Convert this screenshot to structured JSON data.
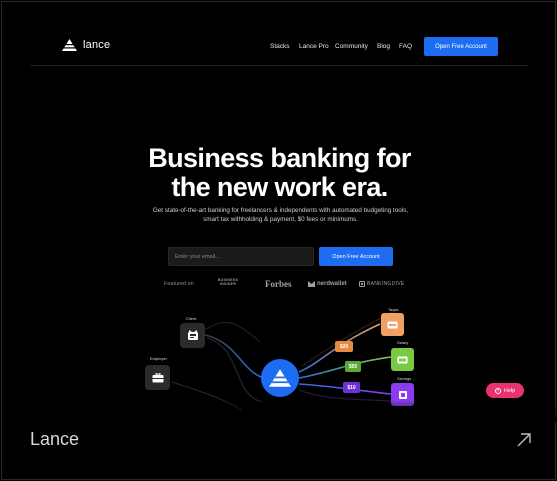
{
  "nav": {
    "brand": "lance",
    "links": [
      "Stacks",
      "Lance Pro",
      "Community",
      "Blog",
      "FAQ"
    ],
    "cta": "Open Free Account"
  },
  "hero": {
    "title_line1": "Business banking for",
    "title_line2": "the new work era.",
    "subtitle": "Get state-of-the-art banking for freelancers & independents with automated budgeting tools, smart tax withholding & payment, $0 fees or minimums.",
    "email_placeholder": "Enter your email...",
    "cta": "Open Free Account"
  },
  "press": {
    "featured_label": "Featured on",
    "business_insider": "BUSINESS INSIDER",
    "forbes": "Forbes",
    "nerdwallet": "nerdwallet",
    "bankingdive": "BANKINGDIVE"
  },
  "diagram": {
    "sources": [
      {
        "label": "Client",
        "icon": "briefcase-icon"
      },
      {
        "label": "Employer",
        "icon": "briefcase-icon"
      }
    ],
    "destinations": [
      {
        "label": "Taxes",
        "amount": "$20",
        "color": "#f0a063"
      },
      {
        "label": "Salary",
        "amount": "$50",
        "color": "#7ac943"
      },
      {
        "label": "Savings",
        "amount": "$10",
        "color": "#8a3cf0"
      }
    ]
  },
  "help": {
    "label": "Help"
  },
  "footer": {
    "title": "Lance"
  },
  "colors": {
    "accent": "#1d6cf2",
    "help": "#e8336f",
    "background": "#000000"
  }
}
